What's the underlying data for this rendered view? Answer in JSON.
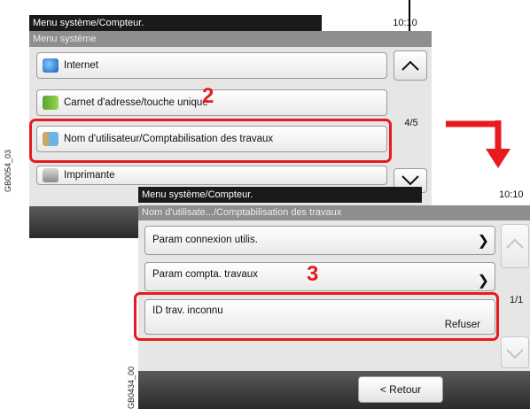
{
  "screen1": {
    "title": "Menu système/Compteur.",
    "time": "10:10",
    "header": "Menu système",
    "items": [
      {
        "label": "Internet",
        "icon": "globe-icon"
      },
      {
        "label": "Carnet d'adresse/touche unique",
        "icon": "address-book-icon"
      },
      {
        "label": "Nom d'utilisateur/Comptabilisation des travaux",
        "icon": "user-accounting-icon"
      },
      {
        "label": "Imprimante",
        "icon": "printer-icon"
      }
    ],
    "page": "4/5",
    "step_number": "2",
    "figure_code": "GB0054_03"
  },
  "screen2": {
    "title": "Menu système/Compteur.",
    "time": "10:10",
    "header": "Nom d'utilisate.../Comptabilisation des travaux",
    "items": [
      {
        "label": "Param connexion utilis."
      },
      {
        "label": "Param compta. travaux"
      },
      {
        "label": "ID trav. inconnu",
        "value": "Refuser"
      }
    ],
    "page": "1/1",
    "back_label": "< Retour",
    "step_number": "3",
    "figure_code": "GB0434_00"
  },
  "colors": {
    "highlight": "#e8191f",
    "titlebar": "#1a1a1a",
    "header": "#8e8e8e"
  }
}
